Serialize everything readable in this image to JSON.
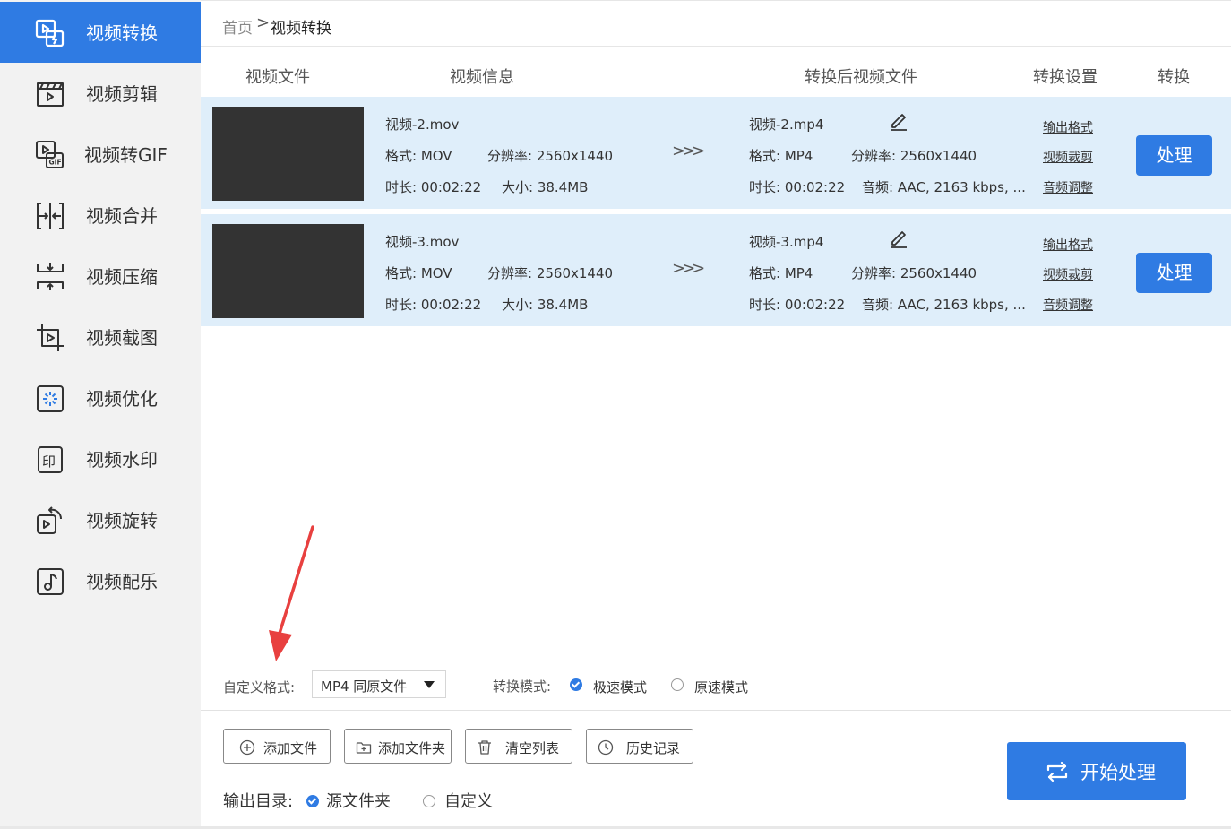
{
  "sidebar": {
    "items": [
      {
        "label": "视频转换",
        "icon": "video-convert-icon",
        "active": true
      },
      {
        "label": "视频剪辑",
        "icon": "clapperboard-icon",
        "active": false
      },
      {
        "label": "视频转GIF",
        "icon": "gif-icon",
        "active": false
      },
      {
        "label": "视频合并",
        "icon": "merge-icon",
        "active": false
      },
      {
        "label": "视频压缩",
        "icon": "compress-icon",
        "active": false
      },
      {
        "label": "视频截图",
        "icon": "crop-icon",
        "active": false
      },
      {
        "label": "视频优化",
        "icon": "optimize-icon",
        "active": false
      },
      {
        "label": "视频水印",
        "icon": "watermark-icon",
        "active": false
      },
      {
        "label": "视频旋转",
        "icon": "rotate-icon",
        "active": false
      },
      {
        "label": "视频配乐",
        "icon": "music-note-icon",
        "active": false
      }
    ]
  },
  "breadcrumb": {
    "home": "首页",
    "separator": ">",
    "current": "视频转换"
  },
  "table": {
    "headers": [
      "视频文件",
      "视频信息",
      "转换后视频文件",
      "转换设置",
      "转换"
    ],
    "rows": [
      {
        "source_name": "视频-2.mov",
        "source_format": "格式: MOV",
        "source_resolution": "分辨率: 2560x1440",
        "source_duration": "时长: 00:02:22",
        "source_size": "大小: 38.4MB",
        "arrow": ">>>",
        "output_name": "视频-2.mp4",
        "output_format": "格式: MP4",
        "output_resolution": "分辨率: 2560x1440",
        "output_duration": "时长: 00:02:22",
        "output_audio": "音频: AAC, 2163 kbps, ...",
        "links": [
          "输出格式",
          "视频裁剪",
          "音频调整"
        ],
        "action": "处理"
      },
      {
        "source_name": "视频-3.mov",
        "source_format": "格式: MOV",
        "source_resolution": "分辨率: 2560x1440",
        "source_duration": "时长: 00:02:22",
        "source_size": "大小: 38.4MB",
        "arrow": ">>>",
        "output_name": "视频-3.mp4",
        "output_format": "格式: MP4",
        "output_resolution": "分辨率: 2560x1440",
        "output_duration": "时长: 00:02:22",
        "output_audio": "音频: AAC, 2163 kbps, ...",
        "links": [
          "输出格式",
          "视频裁剪",
          "音频调整"
        ],
        "action": "处理"
      }
    ]
  },
  "options": {
    "format_label": "自定义格式:",
    "format_value": "MP4 同原文件",
    "mode_label": "转换模式:",
    "mode_fast": "极速模式",
    "mode_original": "原速模式",
    "mode_selected": "fast"
  },
  "toolbar": {
    "add_file": "添加文件",
    "add_folder": "添加文件夹",
    "clear_list": "清空列表",
    "history": "历史记录",
    "start": "开始处理"
  },
  "output": {
    "label": "输出目录:",
    "source_folder": "源文件夹",
    "custom": "自定义",
    "selected": "source_folder"
  },
  "colors": {
    "accent": "#2f7be3",
    "row_bg": "#dfeefa",
    "sidebar_bg": "#f2f2f2",
    "annotation": "#e8403f"
  }
}
